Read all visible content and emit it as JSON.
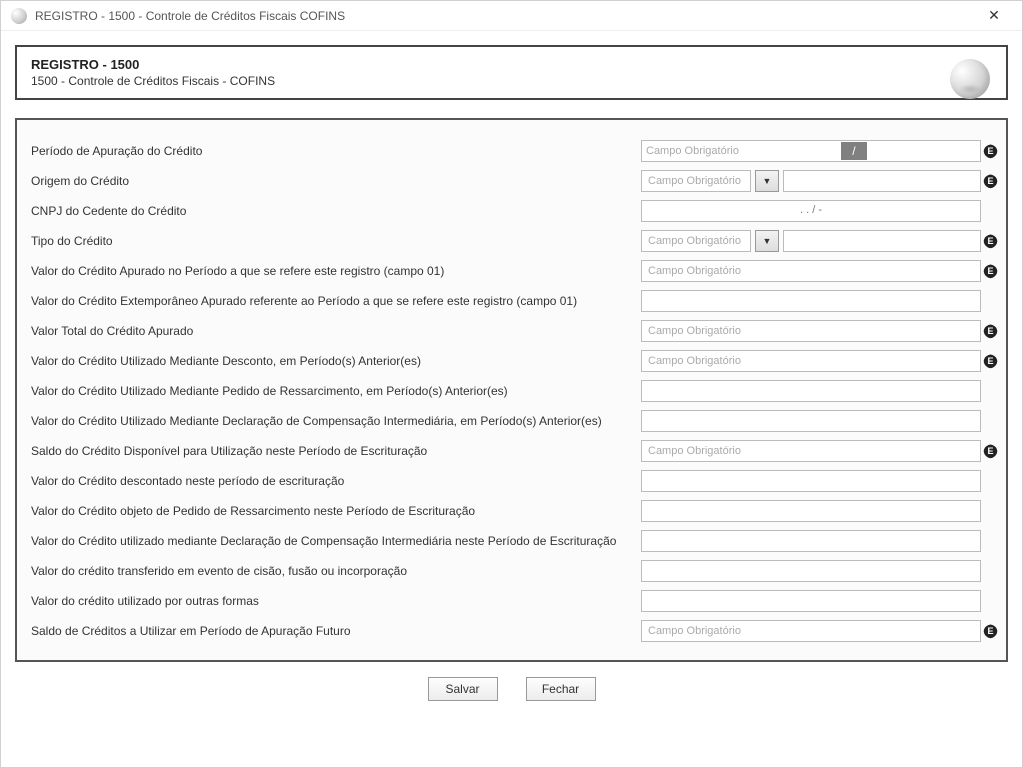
{
  "window": {
    "title": "REGISTRO - 1500 - Controle de Créditos Fiscais  COFINS"
  },
  "header": {
    "title": "REGISTRO - 1500",
    "subtitle": "1500 - Controle de Créditos Fiscais - COFINS"
  },
  "placeholders": {
    "required": "Campo Obrigatório"
  },
  "fields": [
    {
      "label": "Período de Apuração do Crédito",
      "type": "date-required",
      "hasBadge": true
    },
    {
      "label": "Origem do Crédito",
      "type": "combo-required",
      "hasBadge": true
    },
    {
      "label": "CNPJ do Cedente do Crédito",
      "type": "cnpj",
      "mask": ". .   /   -",
      "hasBadge": false
    },
    {
      "label": "Tipo do Crédito",
      "type": "combo-required",
      "hasBadge": true
    },
    {
      "label": "Valor do Crédito Apurado no Período a que se refere este registro (campo 01)",
      "type": "text-required",
      "hasBadge": true
    },
    {
      "label": "Valor do Crédito Extemporâneo Apurado referente ao Período a que se refere este registro (campo 01)",
      "type": "text",
      "hasBadge": false
    },
    {
      "label": "Valor Total do Crédito Apurado",
      "type": "text-required",
      "hasBadge": true
    },
    {
      "label": "Valor do Crédito Utilizado Mediante Desconto, em Período(s) Anterior(es)",
      "type": "text-required",
      "hasBadge": true
    },
    {
      "label": "Valor do Crédito Utilizado Mediante Pedido de Ressarcimento, em Período(s) Anterior(es)",
      "type": "text",
      "hasBadge": false
    },
    {
      "label": "Valor do Crédito Utilizado Mediante Declaração de Compensação Intermediária, em Período(s) Anterior(es)",
      "type": "text",
      "hasBadge": false
    },
    {
      "label": "Saldo do Crédito Disponível para Utilização neste Período de Escrituração",
      "type": "text-required",
      "hasBadge": true
    },
    {
      "label": "Valor do Crédito descontado neste período de escrituração",
      "type": "text",
      "hasBadge": false
    },
    {
      "label": "Valor do Crédito objeto de Pedido de Ressarcimento neste Período de Escrituração",
      "type": "text",
      "hasBadge": false
    },
    {
      "label": "Valor do Crédito utilizado mediante Declaração de Compensação Intermediária neste Período de Escrituração",
      "type": "text",
      "hasBadge": false
    },
    {
      "label": "Valor do crédito transferido em evento de cisão, fusão ou incorporação",
      "type": "text",
      "hasBadge": false
    },
    {
      "label": "Valor do crédito utilizado por outras formas",
      "type": "text",
      "hasBadge": false
    },
    {
      "label": "Saldo de Créditos a Utilizar em Período de Apuração Futuro",
      "type": "text-required",
      "hasBadge": true
    }
  ],
  "footer": {
    "save": "Salvar",
    "close": "Fechar"
  }
}
